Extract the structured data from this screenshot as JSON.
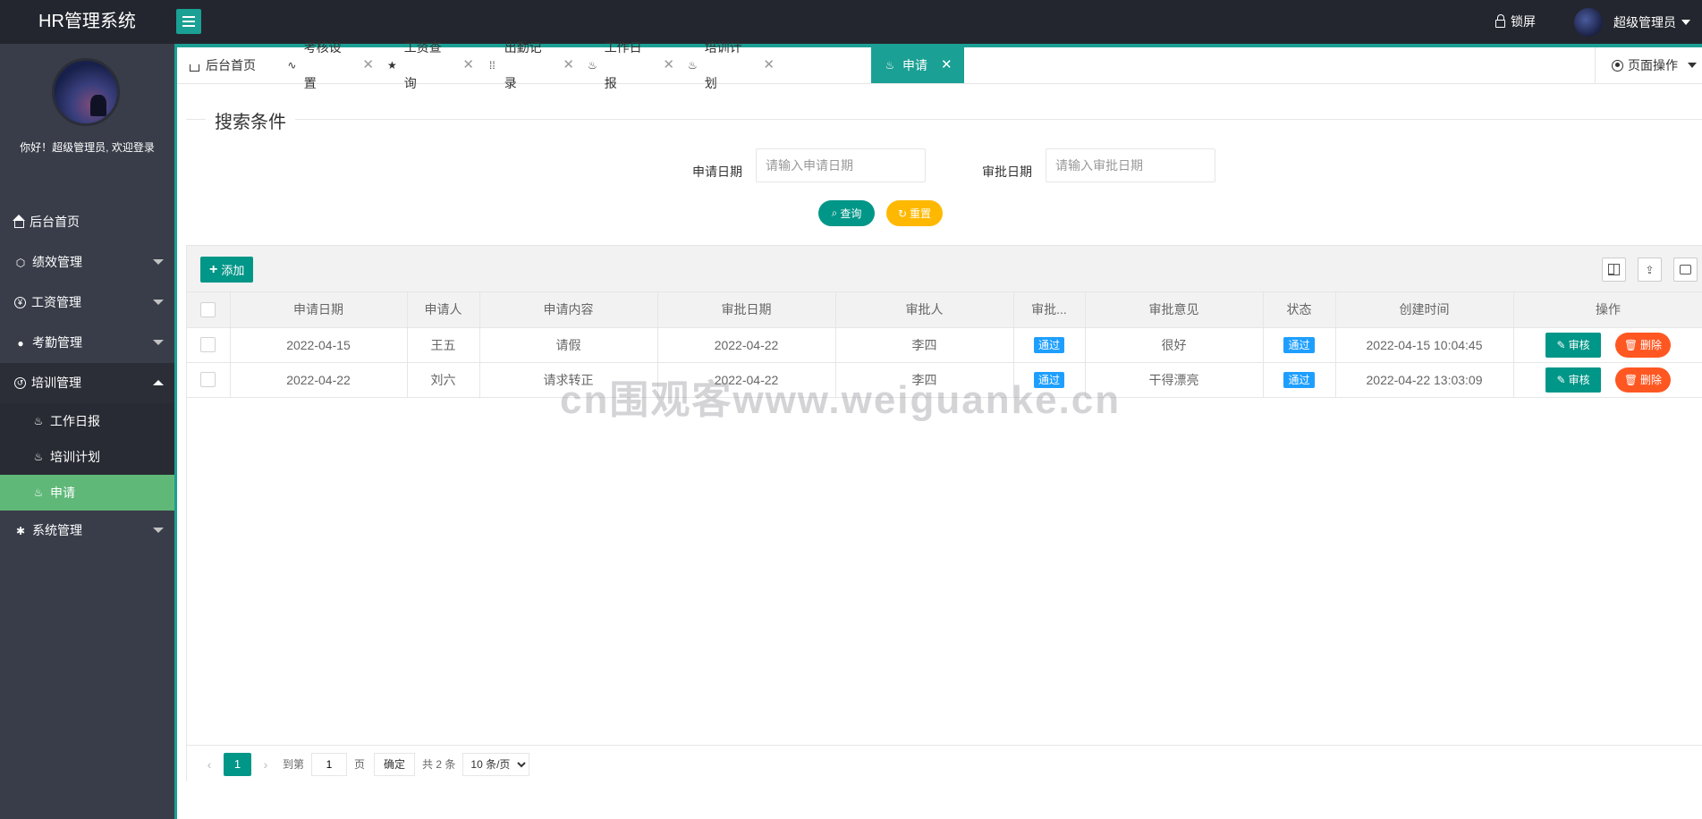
{
  "app": {
    "title": "HR管理系统"
  },
  "header": {
    "lock_label": "锁屏",
    "user_name": "超级管理员"
  },
  "sidebar": {
    "welcome": "你好！超级管理员, 欢迎登录",
    "items": [
      {
        "label": "后台首页",
        "icon": "home-icon"
      },
      {
        "label": "绩效管理",
        "icon": "cube-icon"
      },
      {
        "label": "工资管理",
        "icon": "yen-icon"
      },
      {
        "label": "考勤管理",
        "icon": "chat-icon"
      },
      {
        "label": "培训管理",
        "icon": "refresh-icon"
      },
      {
        "label": "系统管理",
        "icon": "gear-icon"
      }
    ],
    "sub_items": [
      {
        "label": "工作日报",
        "icon": "fire-icon"
      },
      {
        "label": "培训计划",
        "icon": "fire-icon"
      },
      {
        "label": "申请",
        "icon": "fire-icon"
      }
    ]
  },
  "tabs": [
    {
      "label": "后台首页",
      "icon": "home-icon"
    },
    {
      "label": "考核设置",
      "icon": "pulse-icon"
    },
    {
      "label": "工资查询",
      "icon": "star-icon"
    },
    {
      "label": "出勤记录",
      "icon": "grid-dots-icon"
    },
    {
      "label": "工作日报",
      "icon": "fire-icon"
    },
    {
      "label": "培训计划",
      "icon": "fire-icon"
    },
    {
      "label": "申请",
      "icon": "fire-icon"
    }
  ],
  "page_op_label": "页面操作",
  "search": {
    "legend": "搜索条件",
    "apply_date_label": "申请日期",
    "apply_date_placeholder": "请输入申请日期",
    "approve_date_label": "审批日期",
    "approve_date_placeholder": "请输入审批日期",
    "query_label": "查询",
    "reset_label": "重置"
  },
  "toolbar": {
    "add_label": "添加"
  },
  "table": {
    "columns": [
      "申请日期",
      "申请人",
      "申请内容",
      "审批日期",
      "审批人",
      "审批...",
      "审批意见",
      "状态",
      "创建时间",
      "操作"
    ],
    "rows": [
      {
        "apply_date": "2022-04-15",
        "applicant": "王五",
        "content": "请假",
        "approve_date": "2022-04-22",
        "approver": "李四",
        "result": "通过",
        "opinion": "很好",
        "status": "通过",
        "created": "2022-04-15 10:04:45"
      },
      {
        "apply_date": "2022-04-22",
        "applicant": "刘六",
        "content": "请求转正",
        "approve_date": "2022-04-22",
        "approver": "李四",
        "result": "通过",
        "opinion": "干得漂亮",
        "status": "通过",
        "created": "2022-04-22 13:03:09"
      }
    ],
    "audit_label": "审核",
    "delete_label": "删除"
  },
  "pager": {
    "current_page": "1",
    "goto_label": "到第",
    "goto_value": "1",
    "page_unit": "页",
    "confirm_label": "确定",
    "total_label": "共 2 条",
    "page_size": "10 条/页"
  },
  "watermark": "cn围观客www.weiguanke.cn",
  "colors": {
    "accent": "#1aa094",
    "primary": "#009688",
    "warn": "#ffb800",
    "danger": "#ff5722",
    "badge": "#1e9fff",
    "sidebar_bg": "#393d49",
    "header_bg": "#23262e"
  }
}
